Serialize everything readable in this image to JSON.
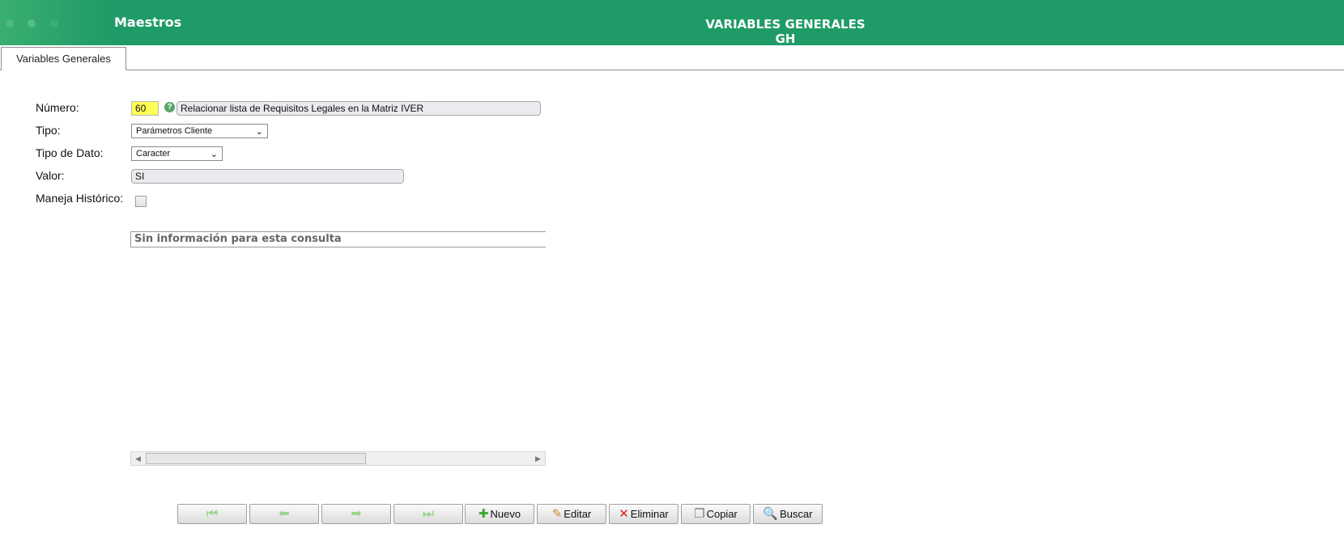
{
  "header": {
    "module_title": "Maestros",
    "page_title": "VARIABLES GENERALES GH",
    "bg_color": "#1f9b68"
  },
  "tab": {
    "label": "Variables Generales"
  },
  "form": {
    "numero_label": "Número:",
    "numero_value": "60",
    "descripcion_value": "Relacionar lista de Requisitos Legales en la Matriz IVER",
    "tipo_label": "Tipo:",
    "tipo_value": "Parámetros Cliente",
    "tipo_dato_label": "Tipo de Dato:",
    "tipo_dato_value": "Caracter",
    "valor_label": "Valor:",
    "valor_value": "SI",
    "historico_label": "Maneja Histórico:",
    "historico_checked": false
  },
  "grid": {
    "empty_message": "Sin información para esta consulta"
  },
  "toolbar": {
    "first_icon": "first-record-icon",
    "prev_icon": "prev-record-icon",
    "next_icon": "next-record-icon",
    "last_icon": "last-record-icon",
    "nuevo_label": "Nuevo",
    "editar_label": "Editar",
    "eliminar_label": "Eliminar",
    "copiar_label": "Copiar",
    "buscar_label": "Buscar"
  }
}
